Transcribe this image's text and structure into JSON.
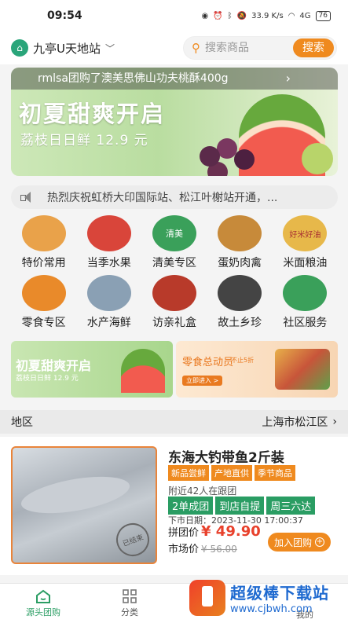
{
  "status": {
    "time": "09:54",
    "speed": "33.9 K/s",
    "network": "4G",
    "battery": "76"
  },
  "header": {
    "station": "九亭U天地站",
    "search_placeholder": "搜索商品",
    "search_button": "搜索"
  },
  "banner": {
    "ticker": "rmlsa团购了澳美思佛山功夫桃酥400g",
    "title": "初夏甜爽开启",
    "subtitle": "荔枝日日鲜 12.9 元"
  },
  "notice": {
    "text": "热烈庆祝虹桥大印国际站、松江叶榭站开通，..."
  },
  "categories": [
    {
      "label": "特价常用",
      "color": "#e9a24a"
    },
    {
      "label": "当季水果",
      "color": "#d9453a"
    },
    {
      "label": "清美专区",
      "color": "#3aa05a",
      "logo": "清美"
    },
    {
      "label": "蛋奶肉禽",
      "color": "#c78a3a"
    },
    {
      "label": "米面粮油",
      "color": "#e7b84a",
      "logo": "好米好油"
    },
    {
      "label": "零食专区",
      "color": "#e98a2a"
    },
    {
      "label": "水产海鲜",
      "color": "#8aa0b4"
    },
    {
      "label": "访亲礼盒",
      "color": "#b83a2a"
    },
    {
      "label": "故土乡珍",
      "color": "#444444"
    },
    {
      "label": "社区服务",
      "color": "#3aa05a"
    }
  ],
  "promos": {
    "left": {
      "title": "初夏甜爽开启",
      "subtitle": "荔枝日日鲜 12.9 元"
    },
    "right": {
      "title": "零食总动员",
      "subtitle": "不止5折",
      "badge": "立即进入 >"
    }
  },
  "region": {
    "label": "地区",
    "value": "上海市松江区"
  },
  "product": {
    "title": "东海大钓带鱼2斤装",
    "tags": [
      "新品尝鲜",
      "产地直供",
      "季节商品"
    ],
    "followers": "附近42人在跟团",
    "green_tags": [
      "2单成团",
      "到店自提",
      "周三六达"
    ],
    "date": "下市日期：2023-11-30 17:00:37",
    "price_label": "拼团价",
    "price": "¥ 49.90",
    "market_label": "市场价",
    "market_price": "¥ 56.00",
    "join_button": "加入团购",
    "stamp": "已结束"
  },
  "tabbar": [
    {
      "label": "源头团购",
      "active": true
    },
    {
      "label": "分类",
      "active": false
    },
    {
      "label": "",
      "active": false
    },
    {
      "label": "我的",
      "active": false
    }
  ],
  "watermark": {
    "title": "超级棒下载站",
    "url": "www.cjbwh.com"
  }
}
